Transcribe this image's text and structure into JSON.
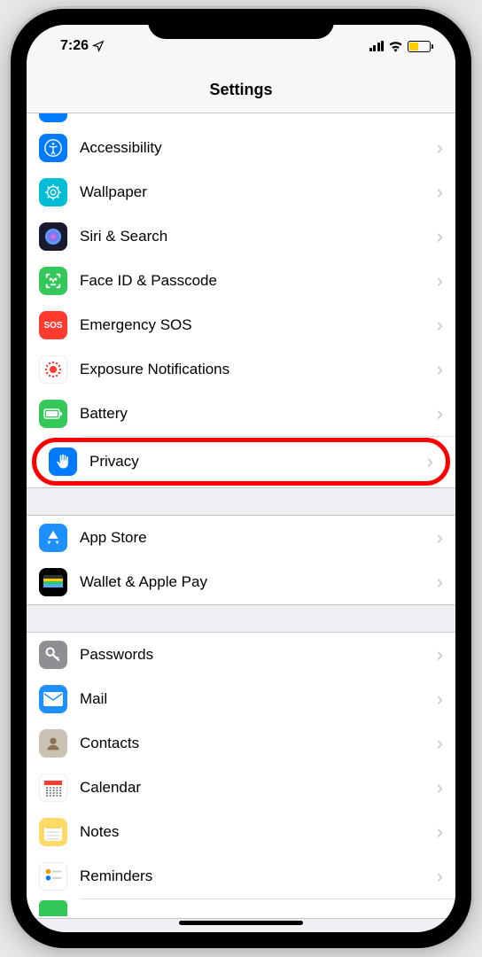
{
  "statusBar": {
    "time": "7:26",
    "locationIcon": "location-arrow"
  },
  "header": {
    "title": "Settings"
  },
  "sections": [
    {
      "id": "general",
      "partialTop": true,
      "items": [
        {
          "id": "accessibility",
          "label": "Accessibility",
          "iconBg": "#007aff",
          "iconFg": "#fff",
          "icon": "accessibility"
        },
        {
          "id": "wallpaper",
          "label": "Wallpaper",
          "iconBg": "#00bcd4",
          "iconFg": "#fff",
          "icon": "wallpaper"
        },
        {
          "id": "siri",
          "label": "Siri & Search",
          "iconBg": "#1a1a2e",
          "iconFg": "#fff",
          "icon": "siri"
        },
        {
          "id": "faceid",
          "label": "Face ID & Passcode",
          "iconBg": "#34c759",
          "iconFg": "#fff",
          "icon": "faceid"
        },
        {
          "id": "sos",
          "label": "Emergency SOS",
          "iconBg": "#ff3b30",
          "iconFg": "#fff",
          "icon": "sos",
          "textIcon": "SOS"
        },
        {
          "id": "exposure",
          "label": "Exposure Notifications",
          "iconBg": "#ffffff",
          "iconFg": "#ff3b30",
          "icon": "exposure",
          "border": true
        },
        {
          "id": "battery",
          "label": "Battery",
          "iconBg": "#34c759",
          "iconFg": "#fff",
          "icon": "battery"
        },
        {
          "id": "privacy",
          "label": "Privacy",
          "iconBg": "#007aff",
          "iconFg": "#fff",
          "icon": "hand",
          "highlighted": true
        }
      ]
    },
    {
      "id": "store",
      "items": [
        {
          "id": "appstore",
          "label": "App Store",
          "iconBg": "#1e90ff",
          "iconFg": "#fff",
          "icon": "appstore"
        },
        {
          "id": "wallet",
          "label": "Wallet & Apple Pay",
          "iconBg": "#000",
          "iconFg": "#fff",
          "icon": "wallet"
        }
      ]
    },
    {
      "id": "accounts",
      "items": [
        {
          "id": "passwords",
          "label": "Passwords",
          "iconBg": "#8e8e93",
          "iconFg": "#fff",
          "icon": "key"
        },
        {
          "id": "mail",
          "label": "Mail",
          "iconBg": "#1e90ff",
          "iconFg": "#fff",
          "icon": "mail"
        },
        {
          "id": "contacts",
          "label": "Contacts",
          "iconBg": "#c9c2b5",
          "iconFg": "#8b7355",
          "icon": "contacts"
        },
        {
          "id": "calendar",
          "label": "Calendar",
          "iconBg": "#ffffff",
          "iconFg": "#ff3b30",
          "icon": "calendar",
          "border": true
        },
        {
          "id": "notes",
          "label": "Notes",
          "iconBg": "#ffd966",
          "iconFg": "#8b7355",
          "icon": "notes"
        },
        {
          "id": "reminders",
          "label": "Reminders",
          "iconBg": "#ffffff",
          "iconFg": "#000",
          "icon": "reminders",
          "border": true
        }
      ],
      "partialBottom": {
        "iconBg": "#34c759"
      }
    }
  ]
}
